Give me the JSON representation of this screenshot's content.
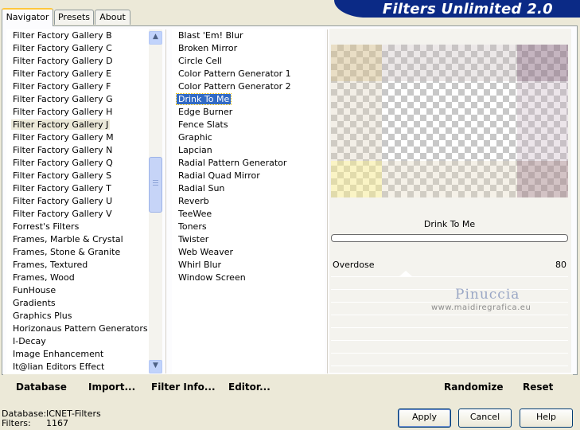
{
  "tabs": [
    {
      "label": "Navigator",
      "active": true
    },
    {
      "label": "Presets",
      "active": false
    },
    {
      "label": "About",
      "active": false
    }
  ],
  "banner": {
    "title": "Filters Unlimited 2.0"
  },
  "categories": [
    "Filter Factory Gallery B",
    "Filter Factory Gallery C",
    "Filter Factory Gallery D",
    "Filter Factory Gallery E",
    "Filter Factory Gallery F",
    "Filter Factory Gallery G",
    "Filter Factory Gallery H",
    "Filter Factory Gallery J",
    "Filter Factory Gallery M",
    "Filter Factory Gallery N",
    "Filter Factory Gallery Q",
    "Filter Factory Gallery S",
    "Filter Factory Gallery T",
    "Filter Factory Gallery U",
    "Filter Factory Gallery V",
    "Forrest's Filters",
    "Frames, Marble & Crystal",
    "Frames, Stone & Granite",
    "Frames, Textured",
    "Frames, Wood",
    "FunHouse",
    "Gradients",
    "Graphics Plus",
    "Horizonaus Pattern Generators",
    "I-Decay",
    "Image Enhancement",
    "It@lian Editors Effect"
  ],
  "selected_category_index": 7,
  "filters": [
    "Blast 'Em! Blur",
    "Broken Mirror",
    "Circle Cell",
    "Color Pattern Generator 1",
    "Color Pattern Generator 2",
    "Drink To Me",
    "Edge Burner",
    "Fence Slats",
    "Graphic",
    "Lapcian",
    "Radial Pattern Generator",
    "Radial Quad Mirror",
    "Radial Sun",
    "Reverb",
    "TeeWee",
    "Toners",
    "Twister",
    "Web Weaver",
    "Whirl Blur",
    "Window Screen"
  ],
  "selected_filter_index": 5,
  "preview": {
    "filter_name": "Drink To Me"
  },
  "parameters": [
    {
      "label": "Overdose",
      "value": "80"
    }
  ],
  "watermark": {
    "line1": "Pinuccia",
    "line2": "www.maidiregrafica.eu"
  },
  "bottom_links": {
    "database": "Database",
    "import": "Import...",
    "filter_info": "Filter Info...",
    "editor": "Editor...",
    "randomize": "Randomize",
    "reset": "Reset"
  },
  "status": {
    "database_label": "Database:",
    "database_value": "ICNET-Filters",
    "filters_label": "Filters:",
    "filters_value": "1167"
  },
  "buttons": {
    "apply": "Apply",
    "cancel": "Cancel",
    "help": "Help"
  },
  "colors": {
    "banner": "#0b2a86",
    "selection": "#316ac5",
    "tab_highlight": "#ffc73c"
  }
}
